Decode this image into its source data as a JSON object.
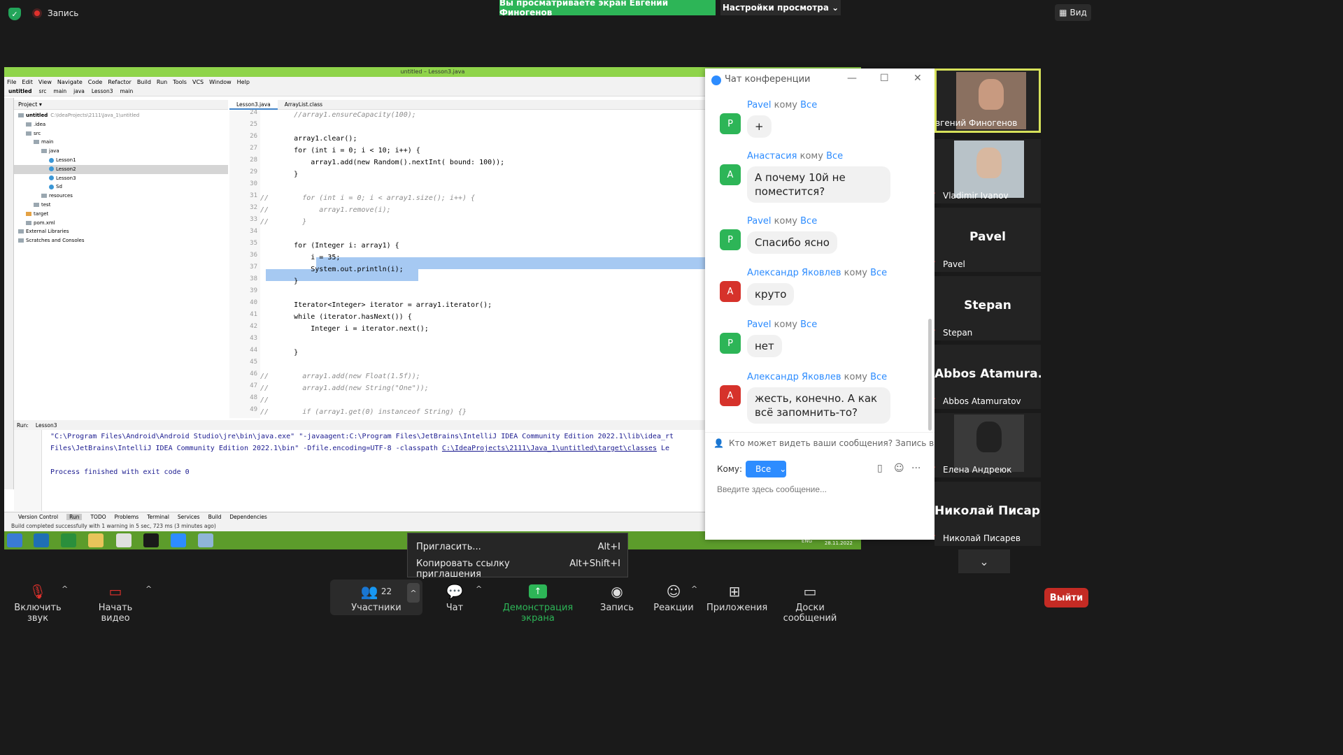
{
  "zoom_top": {
    "recording_label": "Запись",
    "share_banner": "Вы просматриваете экран Евгений Финогенов",
    "view_settings": "Настройки просмотра",
    "view_button": "Вид"
  },
  "ide": {
    "title": "untitled – Lesson3.java",
    "menu": [
      "File",
      "Edit",
      "View",
      "Navigate",
      "Code",
      "Refactor",
      "Build",
      "Run",
      "Tools",
      "VCS",
      "Window",
      "Help"
    ],
    "breadcrumbs": [
      "untitled",
      "src",
      "main",
      "java",
      "Lesson3",
      "main"
    ],
    "project_label": "Project",
    "tree": [
      {
        "label": "untitled",
        "hint": "C:\\IdeaProjects\\2111\\Java_1\\untitled",
        "depth": 0,
        "kind": "folder",
        "bold": true
      },
      {
        "label": ".idea",
        "depth": 1,
        "kind": "folder"
      },
      {
        "label": "src",
        "depth": 1,
        "kind": "folder"
      },
      {
        "label": "main",
        "depth": 2,
        "kind": "folder"
      },
      {
        "label": "java",
        "depth": 3,
        "kind": "folder"
      },
      {
        "label": "Lesson1",
        "depth": 4,
        "kind": "class"
      },
      {
        "label": "Lesson2",
        "depth": 4,
        "kind": "class",
        "selected": true
      },
      {
        "label": "Lesson3",
        "depth": 4,
        "kind": "class"
      },
      {
        "label": "Sd",
        "depth": 4,
        "kind": "class"
      },
      {
        "label": "resources",
        "depth": 3,
        "kind": "folder"
      },
      {
        "label": "test",
        "depth": 2,
        "kind": "folder"
      },
      {
        "label": "target",
        "depth": 1,
        "kind": "folder-orange"
      },
      {
        "label": "pom.xml",
        "depth": 1,
        "kind": "file"
      },
      {
        "label": "External Libraries",
        "depth": 0,
        "kind": "folder"
      },
      {
        "label": "Scratches and Consoles",
        "depth": 0,
        "kind": "folder"
      }
    ],
    "tabs": [
      "Lesson3.java",
      "ArrayList.class"
    ],
    "code_lines": [
      {
        "n": "24",
        "t": "        //array1.ensureCapacity(100);",
        "c": true
      },
      {
        "n": "25",
        "t": ""
      },
      {
        "n": "26",
        "t": "        array1.clear();"
      },
      {
        "n": "27",
        "t": "        for (int i = 0; i < 10; i++) {"
      },
      {
        "n": "28",
        "t": "            array1.add(new Random().nextInt( bound: 100));"
      },
      {
        "n": "29",
        "t": "        }"
      },
      {
        "n": "30",
        "t": ""
      },
      {
        "n": "31",
        "t": "//        for (int i = 0; i < array1.size(); i++) {",
        "c": true
      },
      {
        "n": "32",
        "t": "//            array1.remove(i);",
        "c": true
      },
      {
        "n": "33",
        "t": "//        }",
        "c": true
      },
      {
        "n": "34",
        "t": ""
      },
      {
        "n": "35",
        "t": "        for (Integer i: array1) {"
      },
      {
        "n": "36",
        "t": "            i = 35;"
      },
      {
        "n": "37",
        "t": "            System.out.println(i);"
      },
      {
        "n": "38",
        "t": "        }"
      },
      {
        "n": "39",
        "t": ""
      },
      {
        "n": "40",
        "t": "        Iterator<Integer> iterator = array1.iterator();"
      },
      {
        "n": "41",
        "t": "        while (iterator.hasNext()) {"
      },
      {
        "n": "42",
        "t": "            Integer i = iterator.next();"
      },
      {
        "n": "43",
        "t": ""
      },
      {
        "n": "44",
        "t": "        }"
      },
      {
        "n": "45",
        "t": ""
      },
      {
        "n": "46",
        "t": "//        array1.add(new Float(1.5f));",
        "c": true
      },
      {
        "n": "47",
        "t": "//        array1.add(new String(\"One\"));",
        "c": true
      },
      {
        "n": "48",
        "t": "//",
        "c": true
      },
      {
        "n": "49",
        "t": "//        if (array1.get(0) instanceof String) {}",
        "c": true
      }
    ],
    "run_label": "Run:",
    "run_tab": "Lesson3",
    "output_line1": "\"C:\\Program Files\\Android\\Android Studio\\jre\\bin\\java.exe\" \"-javaagent:C:\\Program Files\\JetBrains\\IntelliJ IDEA Community Edition 2022.1\\lib\\idea_rt",
    "output_line2_a": " Files\\JetBrains\\IntelliJ IDEA Community Edition 2022.1\\bin\" -Dfile.encoding=UTF-8 -classpath ",
    "output_line2_link": "C:\\IdeaProjects\\2111\\Java_1\\untitled\\target\\classes",
    "output_line2_b": " Le",
    "output_line3": "Process finished with exit code 0",
    "bottom_tabs": [
      "Version Control",
      "Run",
      "TODO",
      "Problems",
      "Terminal",
      "Services",
      "Build",
      "Dependencies"
    ],
    "status": "Build completed successfully with 1 warning in 5 sec, 723 ms (3 minutes ago)",
    "taskbar_date": "28.11.2022",
    "taskbar_lang": "ENG"
  },
  "chat": {
    "title": "Чат конференции",
    "to_word": "кому",
    "all_word": "Все",
    "messages": [
      {
        "sender": "Pavel",
        "initial": "P",
        "color": "#2db557",
        "text": "+"
      },
      {
        "sender": "Анастасия",
        "initial": "A",
        "color": "#2db557",
        "text": "А почему 10й не поместится?"
      },
      {
        "sender": "Pavel",
        "initial": "P",
        "color": "#2db557",
        "text": "Спасибо ясно"
      },
      {
        "sender": "Александр Яковлев",
        "initial": "A",
        "color": "#d6322b",
        "text": "круто"
      },
      {
        "sender": "Pavel",
        "initial": "P",
        "color": "#2db557",
        "text": "нет"
      },
      {
        "sender": "Александр Яковлев",
        "initial": "A",
        "color": "#d6322b",
        "text": "жесть, конечно. А как всё запомнить-то?"
      }
    ],
    "who_can_see": "Кто может видеть ваши сообщения? Запись вкл...",
    "to_label": "Кому:",
    "to_value": "Все",
    "input_placeholder": "Введите здесь сообщение..."
  },
  "participants": [
    {
      "name": "вгений Финогенов",
      "video": true,
      "active": true
    },
    {
      "name": "Vladimir Ivanov",
      "video": true
    },
    {
      "name": "Pavel",
      "big": "Pavel"
    },
    {
      "name": "Stepan",
      "big": "Stepan"
    },
    {
      "name": "Abbos Atamuratov",
      "big": "Abbos Atamura..."
    },
    {
      "name": "Елена Андреюк",
      "video": true
    },
    {
      "name": "Николай Писарев",
      "big": "Николай Писар..."
    }
  ],
  "invite_menu": {
    "invite": "Пригласить...",
    "invite_shortcut": "Alt+I",
    "copy_link": "Копировать ссылку приглашения",
    "copy_shortcut": "Alt+Shift+I"
  },
  "toolbar": {
    "unmute": "Включить звук",
    "start_video": "Начать видео",
    "participants": "Участники",
    "participants_count": "22",
    "chat": "Чат",
    "share_screen": "Демонстрация экрана",
    "record": "Запись",
    "reactions": "Реакции",
    "apps": "Приложения",
    "whiteboards": "Доски сообщений",
    "leave": "Выйти"
  },
  "colors": {
    "zoom_green": "#2db557",
    "zoom_blue": "#2d8cff",
    "leave_red": "#c42b24",
    "ide_title_green": "#8fd44a",
    "taskbar_green": "#5c9c2b"
  }
}
